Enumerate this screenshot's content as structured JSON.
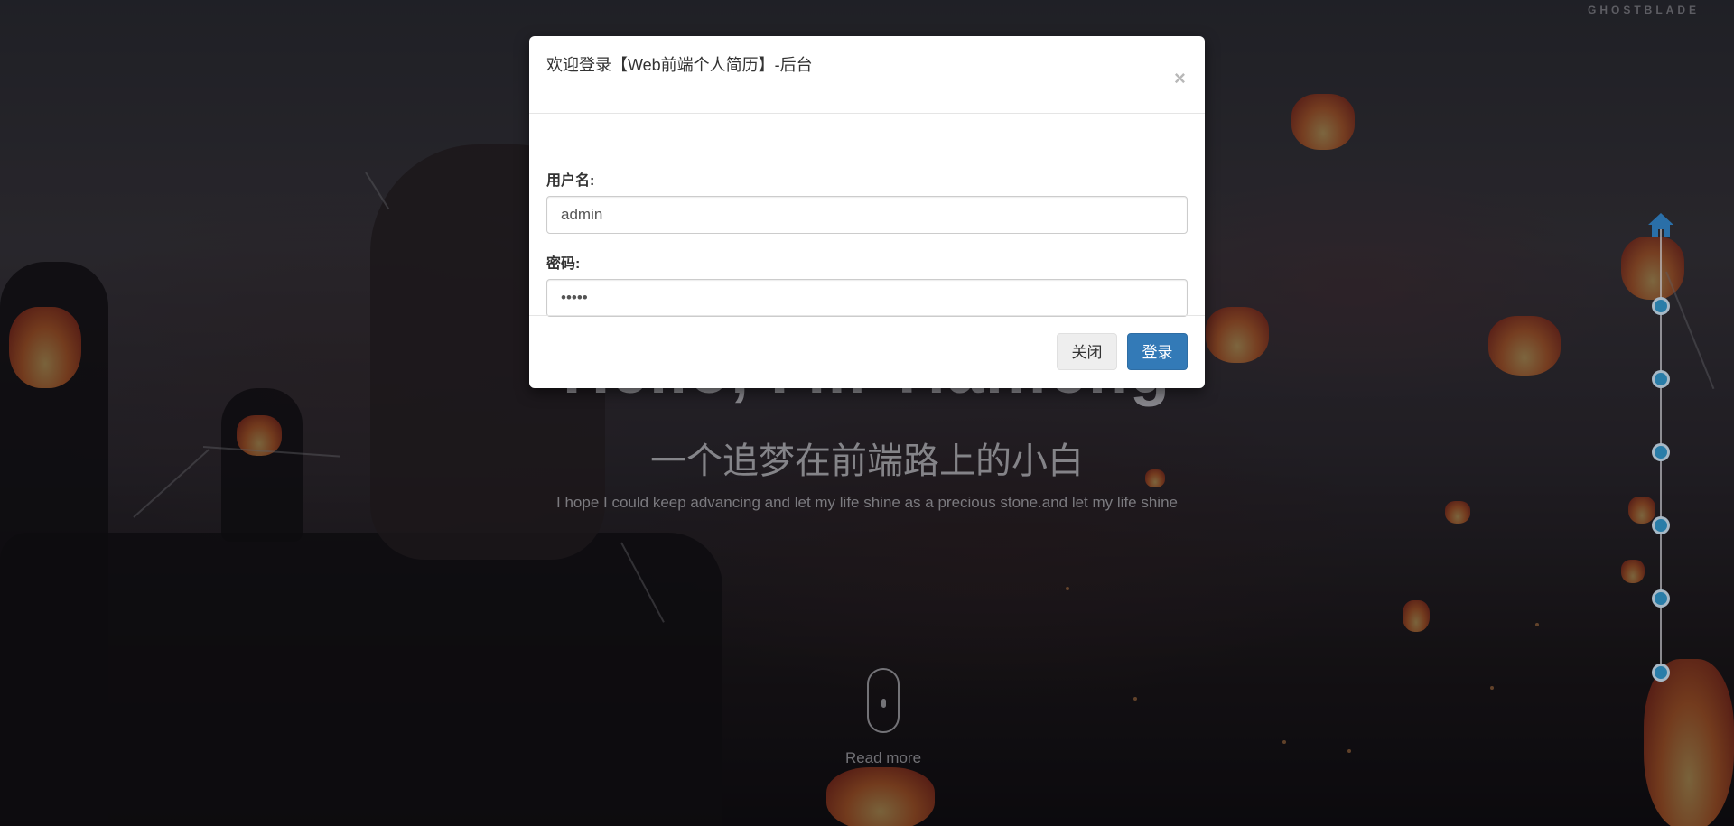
{
  "hero": {
    "title": "Hello, I'm Tianfeng",
    "subtitle": "一个追梦在前端路上的小白",
    "tagline": "I hope I could keep advancing and let my life shine as a precious stone.and let my life shine",
    "read_more": "Read more"
  },
  "logo": {
    "text": "GHOSTBLADE"
  },
  "nav": {
    "home_icon": "home-icon",
    "dots": [
      "section-1",
      "section-2",
      "section-3",
      "section-4",
      "section-5",
      "section-6"
    ],
    "accent_color": "#2a7da8"
  },
  "modal": {
    "title": "欢迎登录【Web前端个人简历】-后台",
    "close_glyph": "×",
    "username_label": "用户名:",
    "username_value": "admin",
    "password_label": "密码:",
    "password_value": "admin",
    "close_button": "关闭",
    "login_button": "登录",
    "primary_color": "#337ab7"
  }
}
